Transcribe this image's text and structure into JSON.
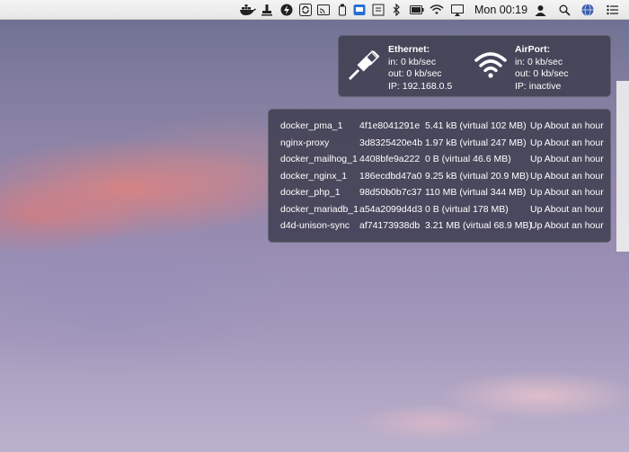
{
  "menubar": {
    "clock": "Mon 00:19",
    "icons": [
      "docker-whale-icon",
      "stamp-icon",
      "bolt-icon",
      "sync-icon",
      "cast-icon",
      "trash-icon",
      "display-icon",
      "bluetooth-icon",
      "battery-icon",
      "wifi-icon",
      "airplay-icon",
      "user-icon",
      "search-icon",
      "globe-icon",
      "list-icon"
    ]
  },
  "network": {
    "ethernet": {
      "title": "Ethernet:",
      "in": "in: 0 kb/sec",
      "out": "out: 0 kb/sec",
      "ip": "IP: 192.168.0.5"
    },
    "airport": {
      "title": "AirPort:",
      "in": "in: 0 kb/sec",
      "out": "out: 0 kb/sec",
      "ip": "IP: inactive"
    }
  },
  "containers": [
    {
      "name": "docker_pma_1",
      "id": "4f1e8041291e",
      "size": "5.41 kB (virtual 102 MB)",
      "status": "Up About an hour"
    },
    {
      "name": "nginx-proxy",
      "id": "3d8325420e4b",
      "size": "1.97 kB (virtual 247 MB)",
      "status": "Up About an hour"
    },
    {
      "name": "docker_mailhog_1",
      "id": "4408bfe9a222",
      "size": "0 B (virtual 46.6 MB)",
      "status": "Up About an hour"
    },
    {
      "name": "docker_nginx_1",
      "id": "186ecdbd47a0",
      "size": "9.25 kB (virtual 20.9 MB)",
      "status": "Up About an hour"
    },
    {
      "name": "docker_php_1",
      "id": "98d50b0b7c37",
      "size": "110 MB (virtual 344 MB)",
      "status": "Up About an hour"
    },
    {
      "name": "docker_mariadb_1",
      "id": "a54a2099d4d3",
      "size": "0 B (virtual 178 MB)",
      "status": "Up About an hour"
    },
    {
      "name": "d4d-unison-sync",
      "id": "af74173938db",
      "size": "3.21 MB (virtual 68.9 MB)",
      "status": "Up About an hour"
    }
  ]
}
